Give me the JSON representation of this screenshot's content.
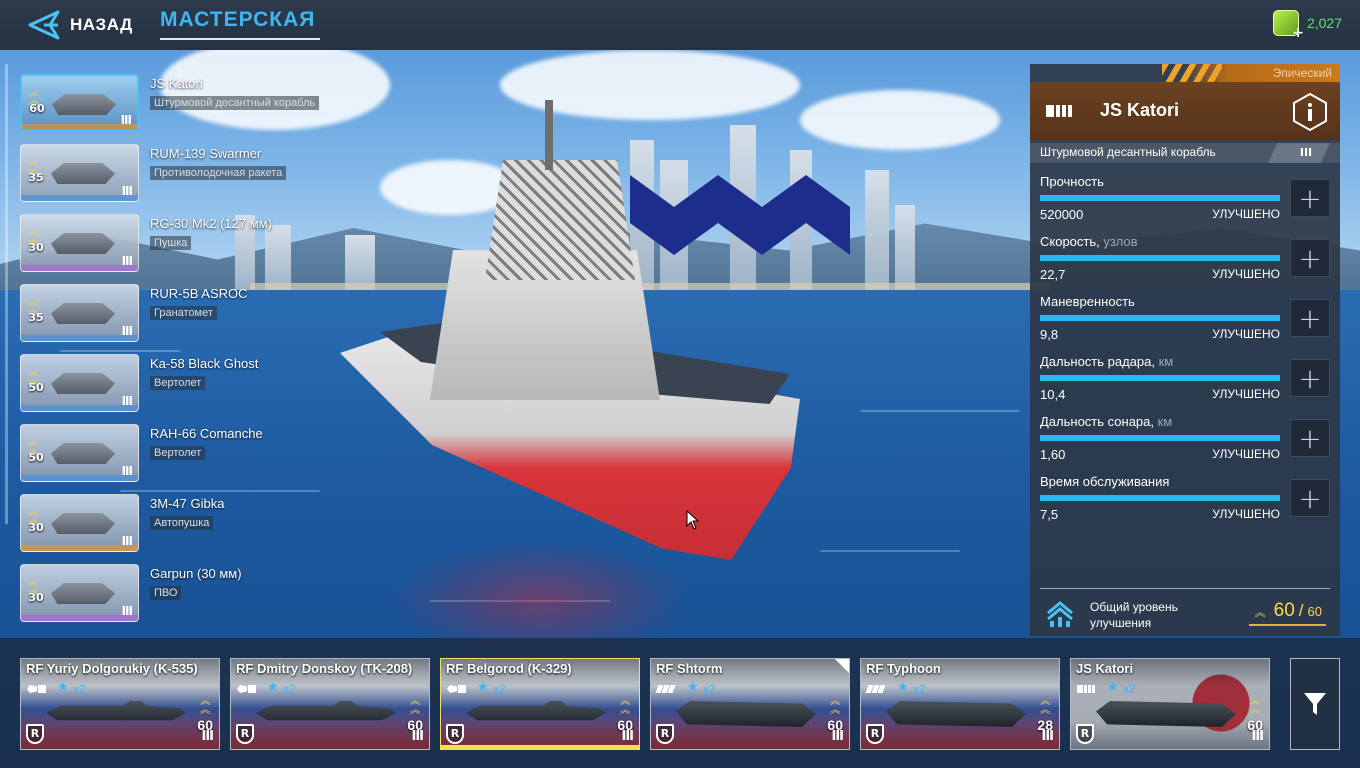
{
  "header": {
    "back_label": "НАЗАД",
    "workshop_tab": "МАСТЕРСКАЯ",
    "currency_value": "2,027",
    "currency_icon": "gold-bar-icon"
  },
  "equipment": [
    {
      "name": "JS Katori",
      "type": "Штурмовой десантный корабль",
      "level": "60",
      "tier": "III",
      "rarity": "leg",
      "selected": true
    },
    {
      "name": "RUM-139 Swarmer",
      "type": "Противолодочная ракета",
      "level": "35",
      "tier": "III",
      "rarity": "rare"
    },
    {
      "name": "RG-30 Mk2 (127 мм)",
      "type": "Пушка",
      "level": "30",
      "tier": "III",
      "rarity": "epic"
    },
    {
      "name": "RUR-5B ASROC",
      "type": "Гранатомет",
      "level": "35",
      "tier": "III",
      "rarity": "rare"
    },
    {
      "name": "Ka-58 Black Ghost",
      "type": "Вертолет",
      "level": "50",
      "tier": "III",
      "rarity": "rare"
    },
    {
      "name": "RAH-66 Comanche",
      "type": "Вертолет",
      "level": "50",
      "tier": "III",
      "rarity": "rare"
    },
    {
      "name": "3M-47 Gibka",
      "type": "Автопушка",
      "level": "30",
      "tier": "III",
      "rarity": "leg"
    },
    {
      "name": "Garpun (30 мм)",
      "type": "ПВО",
      "level": "30",
      "tier": "III",
      "rarity": "epic"
    }
  ],
  "panel": {
    "rarity": "Эпический",
    "ship_name": "JS Katori",
    "ship_class": "Штурмовой десантный корабль",
    "tier": "III",
    "accent_color": "#29b7f2",
    "stats": [
      {
        "label": "Прочность",
        "unit": "",
        "value": "520000",
        "status": "УЛУЧШЕНО",
        "fill": 1.0
      },
      {
        "label": "Скорость,",
        "unit": " узлов",
        "value": "22,7",
        "status": "УЛУЧШЕНО",
        "fill": 1.0
      },
      {
        "label": "Маневренность",
        "unit": "",
        "value": "9,8",
        "status": "УЛУЧШЕНО",
        "fill": 1.0
      },
      {
        "label": "Дальность радара,",
        "unit": " км",
        "value": "10,4",
        "status": "УЛУЧШЕНО",
        "fill": 1.0
      },
      {
        "label": "Дальность сонара,",
        "unit": " км",
        "value": "1,60",
        "status": "УЛУЧШЕНО",
        "fill": 1.0
      },
      {
        "label": "Время обслуживания",
        "unit": "",
        "value": "7,5",
        "status": "УЛУЧШЕНО",
        "fill": 1.0
      }
    ],
    "upgrade_label": "Общий уровень улучшения",
    "upgrade_current": "60",
    "upgrade_separator": "/",
    "upgrade_max": "60"
  },
  "fleet": [
    {
      "name": "RF Yuriy Dolgorukiy (K-535)",
      "stars": "x2",
      "level": "60",
      "tier": "III",
      "kind": "sub",
      "flag": "ru"
    },
    {
      "name": "RF Dmitry Donskoy (TK-208)",
      "stars": "x2",
      "level": "60",
      "tier": "III",
      "kind": "sub",
      "flag": "ru"
    },
    {
      "name": "RF Belgorod (K-329)",
      "stars": "x2",
      "level": "60",
      "tier": "III",
      "kind": "sub",
      "flag": "ru",
      "selected": true
    },
    {
      "name": "RF Shtorm",
      "stars": "x2",
      "level": "60",
      "tier": "III",
      "kind": "carrier",
      "flag": "ru",
      "corner": true
    },
    {
      "name": "RF Typhoon",
      "stars": "x2",
      "level": "28",
      "tier": "III",
      "kind": "carrier",
      "flag": "ru"
    },
    {
      "name": "JS Katori",
      "stars": "x2",
      "level": "60",
      "tier": "III",
      "kind": "ship",
      "flag": "jp"
    }
  ],
  "fleet_badge": "R",
  "filter_icon": "filter-funnel-icon"
}
